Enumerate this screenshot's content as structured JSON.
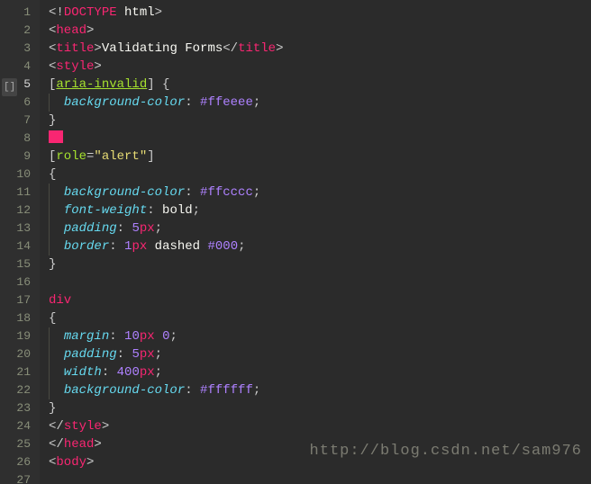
{
  "watermark": "http://blog.csdn.net/sam976",
  "active_line": 5,
  "gutter_marker": "[]",
  "lines": [
    {
      "n": 1,
      "tokens": [
        [
          "p",
          "<!"
        ],
        [
          "tag",
          "DOCTYPE"
        ],
        [
          "txt",
          " html"
        ],
        [
          "p",
          ">"
        ]
      ]
    },
    {
      "n": 2,
      "tokens": [
        [
          "p",
          "<"
        ],
        [
          "tag",
          "head"
        ],
        [
          "p",
          ">"
        ]
      ]
    },
    {
      "n": 3,
      "tokens": [
        [
          "p",
          "<"
        ],
        [
          "tag",
          "title"
        ],
        [
          "p",
          ">"
        ],
        [
          "txt",
          "Validating Forms"
        ],
        [
          "p",
          "</"
        ],
        [
          "tag",
          "title"
        ],
        [
          "p",
          ">"
        ]
      ]
    },
    {
      "n": 4,
      "tokens": [
        [
          "p",
          "<"
        ],
        [
          "tag",
          "style"
        ],
        [
          "p",
          ">"
        ]
      ]
    },
    {
      "n": 5,
      "tokens": [
        [
          "p",
          "["
        ],
        [
          "selU",
          "aria-invalid"
        ],
        [
          "p",
          "]"
        ],
        [
          "txt",
          " "
        ],
        [
          "p",
          "{"
        ]
      ]
    },
    {
      "n": 6,
      "indent": 1,
      "tokens": [
        [
          "prop",
          "background-color"
        ],
        [
          "p",
          ": "
        ],
        [
          "num",
          "#ffeeee"
        ],
        [
          "p",
          ";"
        ]
      ]
    },
    {
      "n": 7,
      "tokens": [
        [
          "p",
          "}"
        ]
      ]
    },
    {
      "n": 8,
      "tokens": [
        [
          "swatch",
          ""
        ]
      ]
    },
    {
      "n": 9,
      "tokens": [
        [
          "p",
          "["
        ],
        [
          "sel",
          "role"
        ],
        [
          "p",
          "="
        ],
        [
          "str",
          "\"alert\""
        ],
        [
          "p",
          "]"
        ]
      ]
    },
    {
      "n": 10,
      "tokens": [
        [
          "p",
          "{"
        ]
      ]
    },
    {
      "n": 11,
      "indent": 1,
      "tokens": [
        [
          "prop",
          "background-color"
        ],
        [
          "p",
          ": "
        ],
        [
          "num",
          "#ffcccc"
        ],
        [
          "p",
          ";"
        ]
      ]
    },
    {
      "n": 12,
      "indent": 1,
      "tokens": [
        [
          "prop",
          "font-weight"
        ],
        [
          "p",
          ": "
        ],
        [
          "txt",
          "bold"
        ],
        [
          "p",
          ";"
        ]
      ]
    },
    {
      "n": 13,
      "indent": 1,
      "tokens": [
        [
          "prop",
          "padding"
        ],
        [
          "p",
          ": "
        ],
        [
          "num",
          "5"
        ],
        [
          "unit",
          "px"
        ],
        [
          "p",
          ";"
        ]
      ]
    },
    {
      "n": 14,
      "indent": 1,
      "tokens": [
        [
          "prop",
          "border"
        ],
        [
          "p",
          ": "
        ],
        [
          "num",
          "1"
        ],
        [
          "unit",
          "px"
        ],
        [
          "txt",
          " dashed "
        ],
        [
          "num",
          "#000"
        ],
        [
          "p",
          ";"
        ]
      ]
    },
    {
      "n": 15,
      "tokens": [
        [
          "p",
          "}"
        ]
      ]
    },
    {
      "n": 16,
      "tokens": []
    },
    {
      "n": 17,
      "tokens": [
        [
          "tag",
          "div"
        ]
      ]
    },
    {
      "n": 18,
      "tokens": [
        [
          "p",
          "{"
        ]
      ]
    },
    {
      "n": 19,
      "indent": 1,
      "tokens": [
        [
          "prop",
          "margin"
        ],
        [
          "p",
          ": "
        ],
        [
          "num",
          "10"
        ],
        [
          "unit",
          "px"
        ],
        [
          "txt",
          " "
        ],
        [
          "num",
          "0"
        ],
        [
          "p",
          ";"
        ]
      ]
    },
    {
      "n": 20,
      "indent": 1,
      "tokens": [
        [
          "prop",
          "padding"
        ],
        [
          "p",
          ": "
        ],
        [
          "num",
          "5"
        ],
        [
          "unit",
          "px"
        ],
        [
          "p",
          ";"
        ]
      ]
    },
    {
      "n": 21,
      "indent": 1,
      "tokens": [
        [
          "prop",
          "width"
        ],
        [
          "p",
          ": "
        ],
        [
          "num",
          "400"
        ],
        [
          "unit",
          "px"
        ],
        [
          "p",
          ";"
        ]
      ]
    },
    {
      "n": 22,
      "indent": 1,
      "tokens": [
        [
          "prop",
          "background-color"
        ],
        [
          "p",
          ": "
        ],
        [
          "num",
          "#ffffff"
        ],
        [
          "p",
          ";"
        ]
      ]
    },
    {
      "n": 23,
      "tokens": [
        [
          "p",
          "}"
        ]
      ]
    },
    {
      "n": 24,
      "tokens": [
        [
          "p",
          "</"
        ],
        [
          "tag",
          "style"
        ],
        [
          "p",
          ">"
        ]
      ]
    },
    {
      "n": 25,
      "tokens": [
        [
          "p",
          "</"
        ],
        [
          "tag",
          "head"
        ],
        [
          "p",
          ">"
        ]
      ]
    },
    {
      "n": 26,
      "tokens": [
        [
          "p",
          "<"
        ],
        [
          "tag",
          "body"
        ],
        [
          "p",
          ">"
        ]
      ]
    },
    {
      "n": 27,
      "tokens": []
    }
  ]
}
